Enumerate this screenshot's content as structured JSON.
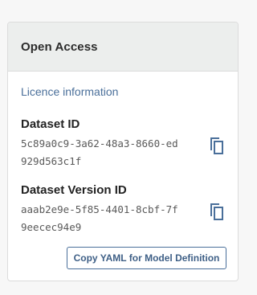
{
  "card": {
    "title": "Open Access",
    "licence_link": "Licence information",
    "fields": [
      {
        "label": "Dataset ID",
        "value": "5c89a0c9-3a62-48a3-8660-ed929d563c1f"
      },
      {
        "label": "Dataset Version ID",
        "value": "aaab2e9e-5f85-4401-8cbf-7f9eecec94e9"
      }
    ],
    "yaml_button_label": "Copy YAML for Model Definition"
  },
  "colors": {
    "accent": "#4a6f9a",
    "header_bg": "#eceeed"
  },
  "icons": {
    "copy": "copy-icon"
  }
}
